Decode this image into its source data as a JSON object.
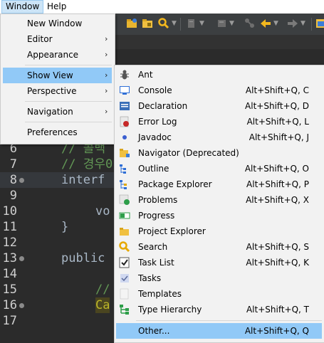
{
  "menubar": {
    "window": "Window",
    "help": "Help"
  },
  "window_menu": {
    "new_window": "New Window",
    "editor": "Editor",
    "appearance": "Appearance",
    "show_view": "Show View",
    "perspective": "Perspective",
    "navigation": "Navigation",
    "preferences": "Preferences",
    "submenu_arrow": "›"
  },
  "show_view_menu": {
    "items": [
      {
        "label": "Ant",
        "shortcut": "",
        "icon": "ant-icon"
      },
      {
        "label": "Console",
        "shortcut": "Alt+Shift+Q, C",
        "icon": "console-icon"
      },
      {
        "label": "Declaration",
        "shortcut": "Alt+Shift+Q, D",
        "icon": "declaration-icon"
      },
      {
        "label": "Error Log",
        "shortcut": "Alt+Shift+Q, L",
        "icon": "error-log-icon"
      },
      {
        "label": "Javadoc",
        "shortcut": "Alt+Shift+Q, J",
        "icon": "javadoc-icon"
      },
      {
        "label": "Navigator (Deprecated)",
        "shortcut": "",
        "icon": "navigator-icon"
      },
      {
        "label": "Outline",
        "shortcut": "Alt+Shift+Q, O",
        "icon": "outline-icon"
      },
      {
        "label": "Package Explorer",
        "shortcut": "Alt+Shift+Q, P",
        "icon": "package-explorer-icon"
      },
      {
        "label": "Problems",
        "shortcut": "Alt+Shift+Q, X",
        "icon": "problems-icon"
      },
      {
        "label": "Progress",
        "shortcut": "",
        "icon": "progress-icon"
      },
      {
        "label": "Project Explorer",
        "shortcut": "",
        "icon": "project-explorer-icon"
      },
      {
        "label": "Search",
        "shortcut": "Alt+Shift+Q, S",
        "icon": "search-icon"
      },
      {
        "label": "Task List",
        "shortcut": "Alt+Shift+Q, K",
        "icon": "task-list-icon"
      },
      {
        "label": "Tasks",
        "shortcut": "",
        "icon": "tasks-icon"
      },
      {
        "label": "Templates",
        "shortcut": "",
        "icon": "templates-icon"
      },
      {
        "label": "Type Hierarchy",
        "shortcut": "Alt+Shift+Q, T",
        "icon": "type-hierarchy-icon"
      },
      {
        "label": "Other...",
        "shortcut": "Alt+Shift+Q, Q",
        "icon": ""
      }
    ]
  },
  "editor": {
    "lines": [
      {
        "no": "6",
        "text": "// 콜백"
      },
      {
        "no": "7",
        "text": "// 경우0"
      },
      {
        "no": "8",
        "text": "interf"
      },
      {
        "no": "9",
        "text": ""
      },
      {
        "no": "10",
        "text": "vo"
      },
      {
        "no": "11",
        "text": "}"
      },
      {
        "no": "12",
        "text": ""
      },
      {
        "no": "13",
        "text": "public"
      },
      {
        "no": "14",
        "text": ""
      },
      {
        "no": "15",
        "text": "//"
      },
      {
        "no": "16",
        "text": "Ca"
      },
      {
        "no": "17",
        "text": ""
      }
    ]
  },
  "colors": {
    "editor_bg": "#2b2b2b",
    "menu_bg": "#f2f2f2",
    "selection": "#91c9f7",
    "comment": "#629755",
    "keyword": "#cc7832"
  }
}
